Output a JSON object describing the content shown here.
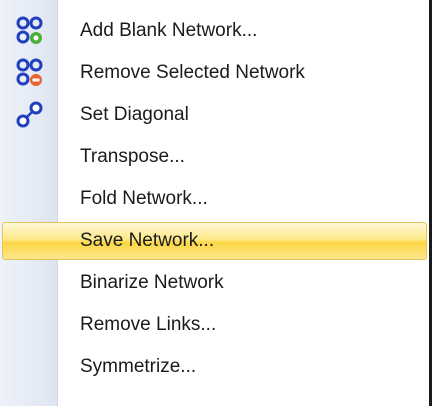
{
  "menu": {
    "items": [
      {
        "label": "Add Blank Network...",
        "icon": "add-network-icon"
      },
      {
        "label": "Remove Selected Network",
        "icon": "remove-network-icon"
      },
      {
        "label": "Set Diagonal",
        "icon": "set-diagonal-icon"
      },
      {
        "label": "Transpose..."
      },
      {
        "label": "Fold Network..."
      },
      {
        "label": "Save Network...",
        "highlighted": true
      },
      {
        "label": "Binarize Network"
      },
      {
        "label": "Remove Links..."
      },
      {
        "label": "Symmetrize..."
      }
    ]
  },
  "colors": {
    "highlight": "#fbd645",
    "icon_node": "#1f3fbf",
    "add_badge": "#4caf3a",
    "remove_badge": "#e8632b"
  }
}
